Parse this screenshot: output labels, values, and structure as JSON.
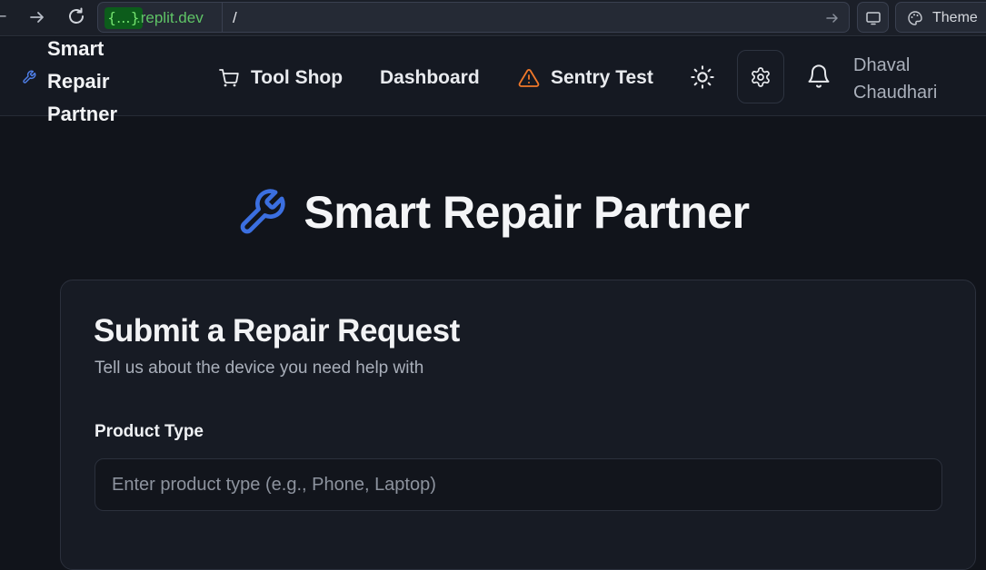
{
  "browser": {
    "url_chip": "{...}",
    "url_domain": ".replit.dev",
    "url_path": "/",
    "theme_label": "Theme"
  },
  "header": {
    "brand": "Smart Repair Partner",
    "nav": {
      "tool_shop": "Tool Shop",
      "dashboard": "Dashboard",
      "sentry_test": "Sentry Test"
    },
    "user_name": "Dhaval Chaudhari"
  },
  "main": {
    "title": "Smart Repair Partner",
    "card": {
      "title": "Submit a Repair Request",
      "description": "Tell us about the device you need help with",
      "product_type": {
        "label": "Product Type",
        "placeholder": "Enter product type (e.g., Phone, Laptop)",
        "value": ""
      }
    }
  },
  "colors": {
    "accent_blue": "#3b6fe0",
    "warning_orange": "#f0782a",
    "domain_green": "#5fc466"
  },
  "icons": [
    "back-arrow-icon",
    "forward-arrow-icon",
    "reload-icon",
    "go-arrow-icon",
    "monitor-icon",
    "palette-icon",
    "wrench-icon",
    "cart-icon",
    "warning-icon",
    "sun-icon",
    "gear-icon",
    "bell-icon"
  ]
}
